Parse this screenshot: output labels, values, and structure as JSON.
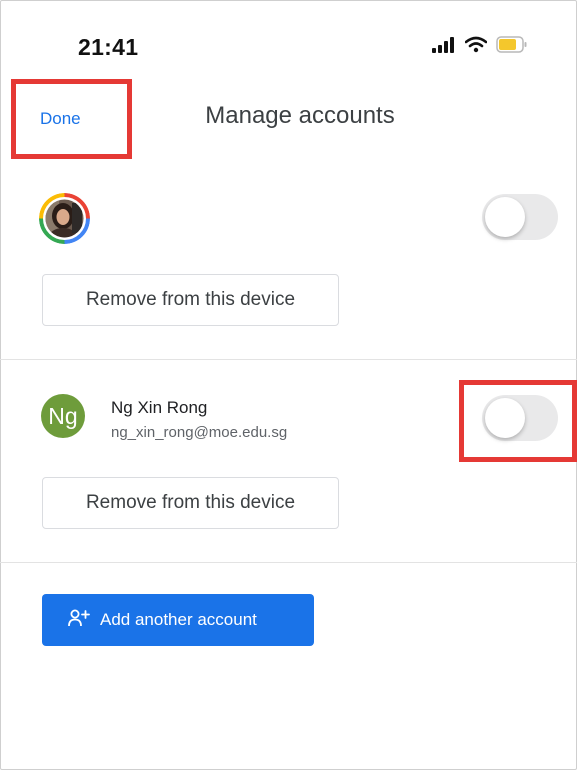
{
  "status_bar": {
    "time": "21:41",
    "icons": [
      "signal-icon",
      "wifi-icon",
      "battery-icon"
    ]
  },
  "header": {
    "done_label": "Done",
    "title": "Manage accounts"
  },
  "accounts": [
    {
      "avatar": "profile-photo",
      "toggle_on": false,
      "remove_label": "Remove from this device"
    },
    {
      "avatar_initials": "Ng",
      "name": "Ng Xin Rong",
      "email": "ng_xin_rong@moe.edu.sg",
      "toggle_on": false,
      "remove_label": "Remove from this device"
    }
  ],
  "add_account": {
    "icon": "add-person-icon",
    "label": "Add another account"
  },
  "colors": {
    "accent": "#1a73e8",
    "highlight": "#e53935",
    "avatar_bg": "#6e9c3b",
    "toggle_off": "#e9e9ea"
  }
}
